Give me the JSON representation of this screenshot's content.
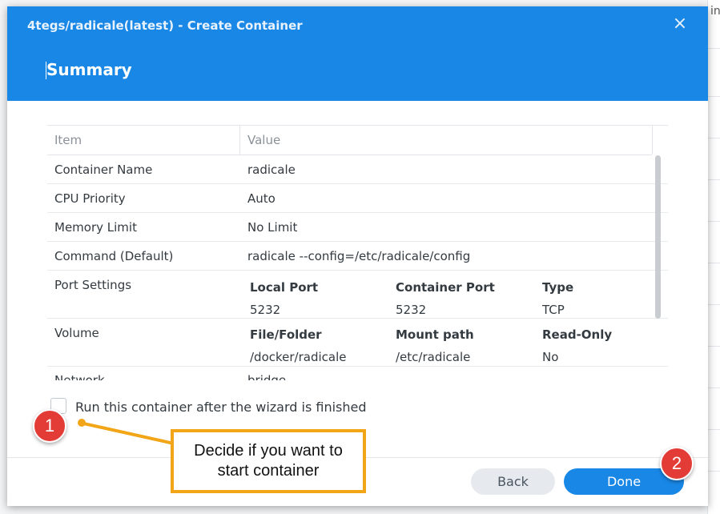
{
  "background": {
    "peek_text": "in"
  },
  "dialog": {
    "window_title": "4tegs/radicale(latest) - Create Container",
    "close_icon": "×",
    "section_title": "Summary"
  },
  "table": {
    "headers": {
      "item": "Item",
      "value": "Value"
    },
    "rows": [
      {
        "label": "Container Name",
        "value": "radicale"
      },
      {
        "label": "CPU Priority",
        "value": "Auto"
      },
      {
        "label": "Memory Limit",
        "value": "No Limit"
      },
      {
        "label": "Command (Default)",
        "value": "radicale --config=/etc/radicale/config"
      }
    ],
    "port_settings": {
      "label": "Port Settings",
      "headers": [
        "Local Port",
        "Container Port",
        "Type"
      ],
      "values": [
        "5232",
        "5232",
        "TCP"
      ]
    },
    "volume": {
      "label": "Volume",
      "headers": [
        "File/Folder",
        "Mount path",
        "Read-Only"
      ],
      "values": [
        "/docker/radicale",
        "/etc/radicale",
        "No"
      ]
    },
    "network": {
      "label": "Network",
      "value": "bridge"
    }
  },
  "run_after": {
    "label": "Run this container after the wizard is finished",
    "checked": false
  },
  "buttons": {
    "back": "Back",
    "done": "Done"
  },
  "annotations": {
    "marker_1": "1",
    "marker_2": "2",
    "callout": "Decide if you want to start container",
    "accent_color": "#f2a516",
    "marker_color": "#e33b35"
  },
  "colors": {
    "header": "#1987e6",
    "primary_button": "#1987e6"
  }
}
